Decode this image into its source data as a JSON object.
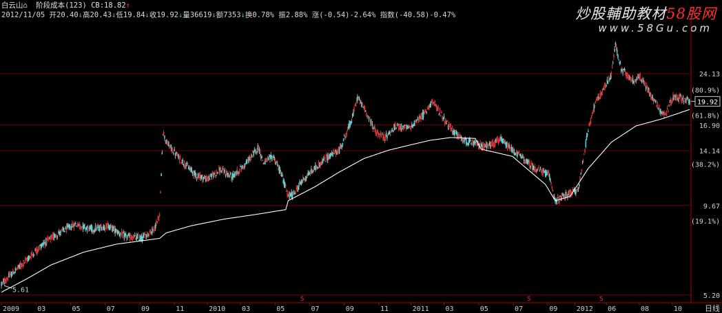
{
  "header": {
    "stock_name": "白云山",
    "indicator": "阶段成本(123)",
    "cb": "CB:18.82",
    "cb_arrow": "↑",
    "line2": [
      {
        "text": "2012/11/05",
        "cls": ""
      },
      {
        "text": " 开20.40",
        "cls": ""
      },
      {
        "text": "↓",
        "cls": "grn"
      },
      {
        "text": "高20.43",
        "cls": ""
      },
      {
        "text": "↓",
        "cls": "grn"
      },
      {
        "text": "低19.84",
        "cls": ""
      },
      {
        "text": "↓",
        "cls": "grn"
      },
      {
        "text": "收19.92",
        "cls": ""
      },
      {
        "text": "↓",
        "cls": "grn"
      },
      {
        "text": "量36619",
        "cls": ""
      },
      {
        "text": "↓",
        "cls": "grn"
      },
      {
        "text": "额7353",
        "cls": ""
      },
      {
        "text": "↓",
        "cls": "grn"
      },
      {
        "text": "换0.78%",
        "cls": ""
      },
      {
        "text": " 振2.88%",
        "cls": ""
      },
      {
        "text": " 涨(-0.54)-2.64%",
        "cls": ""
      },
      {
        "text": " 指数(-40.58)-0.47%",
        "cls": ""
      }
    ]
  },
  "watermark": {
    "line1_a": "炒股輔助教材",
    "line1_b": "58股网",
    "line2": "www.58Gu.com"
  },
  "chart_data": {
    "type": "candlestick",
    "period_label": "日线",
    "y_scale": "log",
    "ylim": [
      5.0,
      32.0
    ],
    "y_ticks": [
      {
        "value": 24.13,
        "label": "24.13"
      },
      {
        "value": 16.9,
        "label": "16.90"
      },
      {
        "value": 14.14,
        "label": "14.14"
      },
      {
        "value": 9.67,
        "label": "9.67"
      },
      {
        "value": 5.2,
        "label": "5.20"
      }
    ],
    "percent_labels": [
      {
        "value": 21.6,
        "label": "(80.9%)"
      },
      {
        "value": 18.1,
        "label": "(61.8%)"
      },
      {
        "value": 12.9,
        "label": "(38.2%)"
      },
      {
        "value": 8.7,
        "label": "(19.1%)"
      }
    ],
    "current_price": 19.92,
    "low_marker": "5.61",
    "x_ticks": [
      "2009",
      "03",
      "05",
      "07",
      "09",
      "11",
      "2010",
      "03",
      "05",
      "07",
      "09",
      "11",
      "2011",
      "03",
      "05",
      "07",
      "09",
      "2012",
      "06",
      "08",
      "10"
    ],
    "x_tick_index": [
      0,
      42,
      84,
      126,
      168,
      210,
      250,
      290,
      332,
      374,
      416,
      458,
      497,
      537,
      579,
      621,
      663,
      696,
      734,
      774,
      814
    ],
    "event_markers": [
      {
        "index": 365,
        "label": "S"
      },
      {
        "index": 640,
        "label": "S"
      },
      {
        "index": 728,
        "label": "S"
      }
    ],
    "price_path": [
      [
        0,
        5.6
      ],
      [
        15,
        6.1
      ],
      [
        30,
        6.6
      ],
      [
        50,
        7.4
      ],
      [
        70,
        8.0
      ],
      [
        90,
        8.5
      ],
      [
        110,
        8.2
      ],
      [
        130,
        8.4
      ],
      [
        150,
        7.8
      ],
      [
        170,
        7.7
      ],
      [
        185,
        8.2
      ],
      [
        192,
        9.0
      ],
      [
        196,
        16.2
      ],
      [
        200,
        15.0
      ],
      [
        215,
        13.5
      ],
      [
        235,
        12.0
      ],
      [
        250,
        11.6
      ],
      [
        265,
        12.4
      ],
      [
        280,
        11.8
      ],
      [
        295,
        12.8
      ],
      [
        312,
        14.5
      ],
      [
        318,
        13.0
      ],
      [
        330,
        13.6
      ],
      [
        340,
        12.0
      ],
      [
        348,
        10.3
      ],
      [
        355,
        10.5
      ],
      [
        365,
        11.5
      ],
      [
        380,
        12.5
      ],
      [
        395,
        13.5
      ],
      [
        410,
        14.2
      ],
      [
        425,
        17.5
      ],
      [
        432,
        20.5
      ],
      [
        440,
        19.0
      ],
      [
        455,
        16.0
      ],
      [
        465,
        15.5
      ],
      [
        480,
        16.8
      ],
      [
        495,
        16.5
      ],
      [
        505,
        17.5
      ],
      [
        515,
        18.5
      ],
      [
        522,
        20.0
      ],
      [
        530,
        18.8
      ],
      [
        545,
        16.5
      ],
      [
        560,
        15.2
      ],
      [
        575,
        14.8
      ],
      [
        590,
        14.6
      ],
      [
        605,
        15.3
      ],
      [
        615,
        14.5
      ],
      [
        630,
        13.6
      ],
      [
        645,
        12.6
      ],
      [
        655,
        12.3
      ],
      [
        665,
        11.9
      ],
      [
        672,
        10.0
      ],
      [
        680,
        10.2
      ],
      [
        690,
        10.5
      ],
      [
        700,
        10.8
      ],
      [
        712,
        16.5
      ],
      [
        720,
        19.5
      ],
      [
        728,
        21.0
      ],
      [
        740,
        24.0
      ],
      [
        745,
        29.5
      ],
      [
        752,
        25.0
      ],
      [
        765,
        23.0
      ],
      [
        775,
        23.5
      ],
      [
        785,
        21.5
      ],
      [
        795,
        19.5
      ],
      [
        805,
        18.0
      ],
      [
        815,
        20.5
      ],
      [
        825,
        20.4
      ],
      [
        835,
        19.92
      ]
    ],
    "cost_path": [
      [
        0,
        5.3
      ],
      [
        30,
        5.8
      ],
      [
        60,
        6.4
      ],
      [
        100,
        7.0
      ],
      [
        140,
        7.4
      ],
      [
        175,
        7.6
      ],
      [
        192,
        7.7
      ],
      [
        200,
        8.0
      ],
      [
        230,
        8.4
      ],
      [
        270,
        8.8
      ],
      [
        310,
        9.1
      ],
      [
        345,
        9.4
      ],
      [
        348,
        10.0
      ],
      [
        380,
        11.0
      ],
      [
        410,
        12.2
      ],
      [
        440,
        13.4
      ],
      [
        470,
        14.2
      ],
      [
        495,
        14.7
      ],
      [
        520,
        15.2
      ],
      [
        545,
        15.5
      ],
      [
        575,
        15.4
      ],
      [
        582,
        14.3
      ],
      [
        620,
        13.6
      ],
      [
        660,
        11.2
      ],
      [
        672,
        10.0
      ],
      [
        690,
        10.3
      ],
      [
        712,
        12.5
      ],
      [
        740,
        15.0
      ],
      [
        770,
        16.8
      ],
      [
        800,
        17.6
      ],
      [
        835,
        18.82
      ]
    ]
  }
}
